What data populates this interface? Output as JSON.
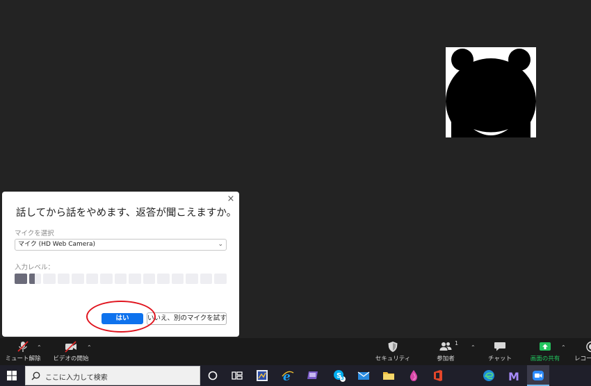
{
  "dialog": {
    "title": "話してから話をやめます、返答が聞こえますか。",
    "close_icon": "×",
    "mic_select_label": "マイクを選択",
    "mic_selected": "マイク (HD Web Camera)",
    "input_level_label": "入力レベル：",
    "input_level_fraction": 0.1,
    "level_segments": 15,
    "yes_label": "はい",
    "no_label": "いいえ、別のマイクを試す",
    "highlight_color": "#e0141e",
    "primary_color": "#0e72ed"
  },
  "toolbar": {
    "unmute_label": "ミュート解除",
    "start_video_label": "ビデオの開始",
    "security_label": "セキュリティ",
    "participants_label": "参加者",
    "participants_count": "1",
    "chat_label": "チャット",
    "share_label": "画面の共有",
    "record_label": "レコー",
    "share_color": "#22c55e"
  },
  "taskbar": {
    "search_placeholder": "ここに入力して検索",
    "skype_badge": "3"
  }
}
